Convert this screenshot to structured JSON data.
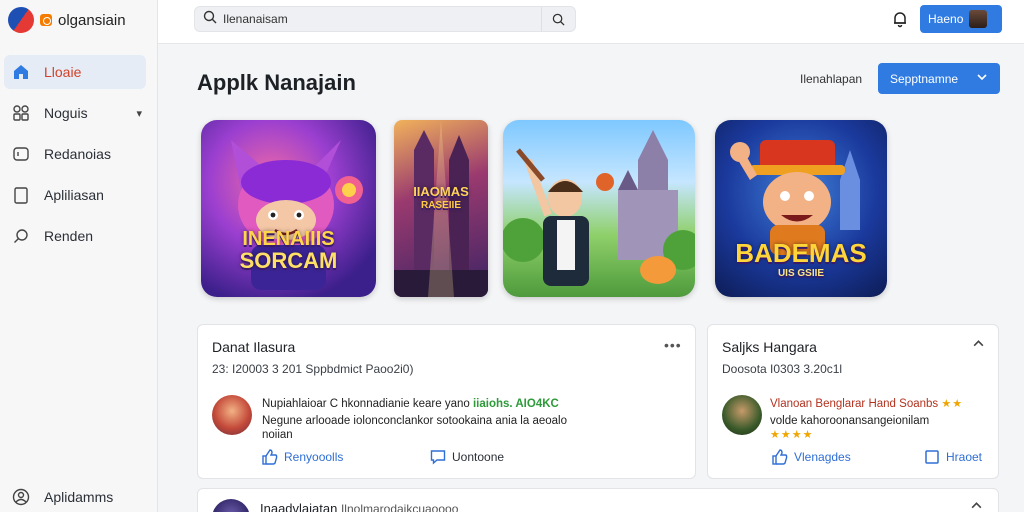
{
  "brand": {
    "name": "olgansiain"
  },
  "sidebar": {
    "items": [
      {
        "label": "Lloaie",
        "icon": "home-icon",
        "active": true
      },
      {
        "label": "Noguis",
        "icon": "grid-icon",
        "has_chevron": true
      },
      {
        "label": "Redanoias",
        "icon": "gamepad-icon"
      },
      {
        "label": "Apliliasan",
        "icon": "tablet-icon"
      },
      {
        "label": "Renden",
        "icon": "search-icon"
      }
    ],
    "bottom_item": {
      "label": "Aplidamms",
      "icon": "user-circle-icon"
    }
  },
  "topbar": {
    "search_value": "Ilenanaisam",
    "user_button_label": "Haeno"
  },
  "main": {
    "title": "Applk Nanajain",
    "header_link": "Ilenahlapan",
    "select_label": "Sepptnamne"
  },
  "games": [
    {
      "title_line1": "INENAIIIS",
      "title_line2": "SORCAM"
    },
    {
      "title_line1": "IIAOMAS",
      "title_line2": "RASEIIE"
    },
    {
      "title_line1": "",
      "title_line2": ""
    },
    {
      "title_line1": "BADEMAS",
      "title_line2": "UIS GSIIE"
    }
  ],
  "cards": [
    {
      "title": "Danat Ilasura",
      "meta": "23: I20003 3 201  Sppbdmict   Paoo2i0)",
      "line1": "Nupiahlaioar  C hkonnadianie keare yano",
      "line1_green": "iiaiohs.  AIO4KC",
      "line2": "Negune arlooade iolonconclankor sotookaina ania la aeoalo",
      "line3": "noiian",
      "action1": "Renyooolls",
      "action2": "Uontoone"
    },
    {
      "title": "Saljks Hangara",
      "meta": "Doosota I0303 3.20c1l",
      "line1": "Vlanoan Benglarar Hand Soanbs",
      "line2": "volde kahoroonansangeionilam",
      "action1": "Vlenagdes",
      "action2": "Hraoet"
    }
  ],
  "card3": {
    "title": "Inaadvlaiatan",
    "subtitle": "Ilnolmarodaikcuaoooo"
  }
}
